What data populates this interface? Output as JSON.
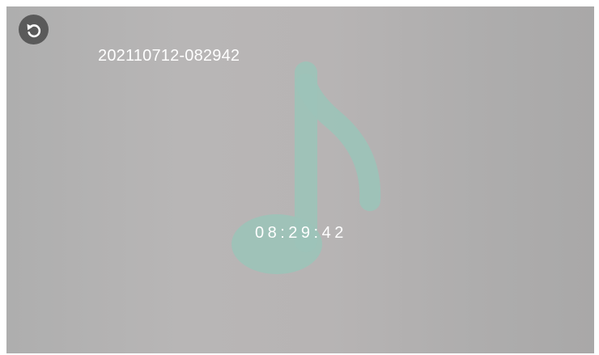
{
  "recording": {
    "name": "202110712-082942",
    "time": "08:29:42"
  },
  "icons": {
    "back": "undo-arrow-icon",
    "music": "music-note-icon"
  },
  "colors": {
    "background": "#b6b4b4",
    "note": "#9dc3b8",
    "button": "#5a5a5a",
    "text": "#ffffff"
  }
}
